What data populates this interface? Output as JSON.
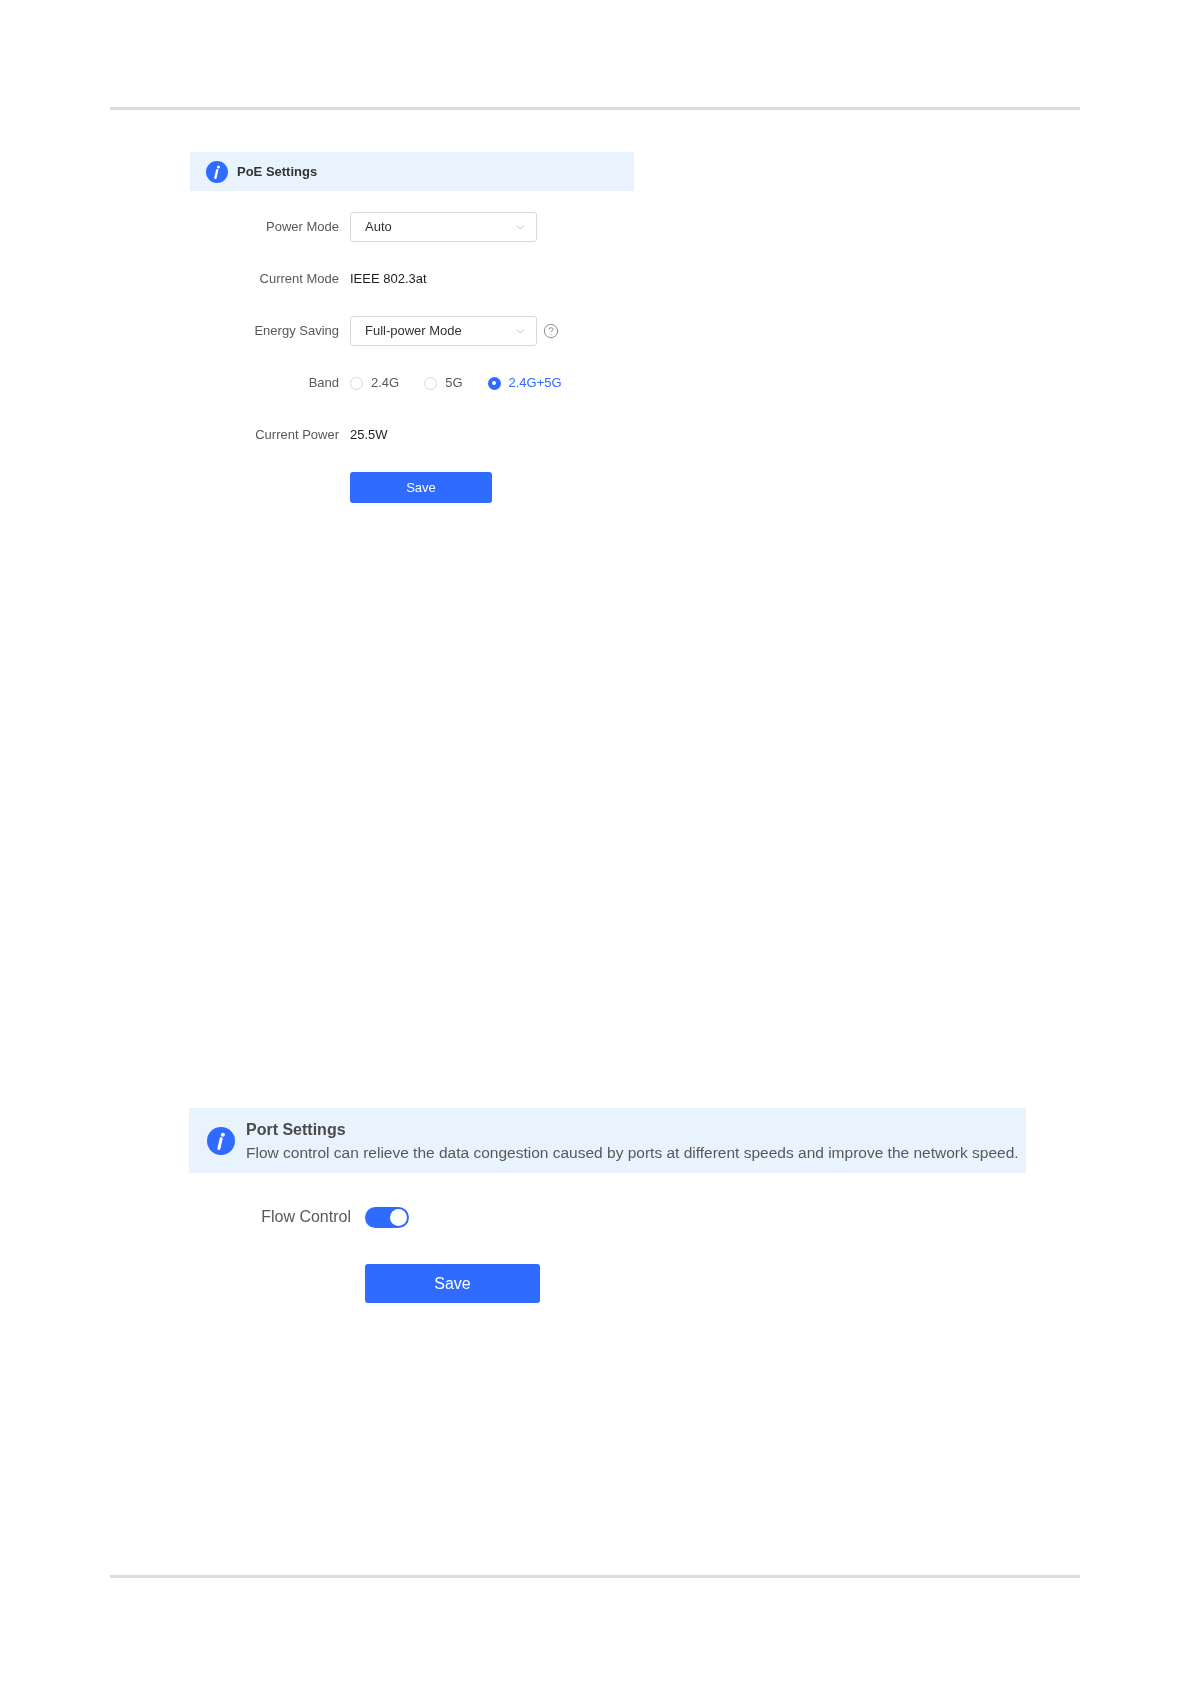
{
  "poe_settings": {
    "title": "PoE Settings",
    "fields": [
      {
        "kind": "select",
        "label": "Power Mode",
        "value": "Auto"
      },
      {
        "kind": "text",
        "label": "Current Mode",
        "value": "IEEE 802.3at"
      },
      {
        "kind": "select",
        "label": "Energy Saving",
        "value": "Full-power Mode",
        "help": true
      },
      {
        "kind": "radio",
        "label": "Band",
        "options": [
          {
            "label": "2.4G",
            "selected": false
          },
          {
            "label": "5G",
            "selected": false
          },
          {
            "label": "2.4G+5G",
            "selected": true
          }
        ]
      },
      {
        "kind": "text",
        "label": "Current Power",
        "value": "25.5W"
      }
    ],
    "save_button": "Save"
  },
  "port_settings": {
    "title": "Port Settings",
    "description": "Flow control can relieve the data congestion caused by ports at different speeds and improve the network speed.",
    "flow_control": {
      "label": "Flow Control",
      "on": true
    },
    "save_button": "Save"
  }
}
